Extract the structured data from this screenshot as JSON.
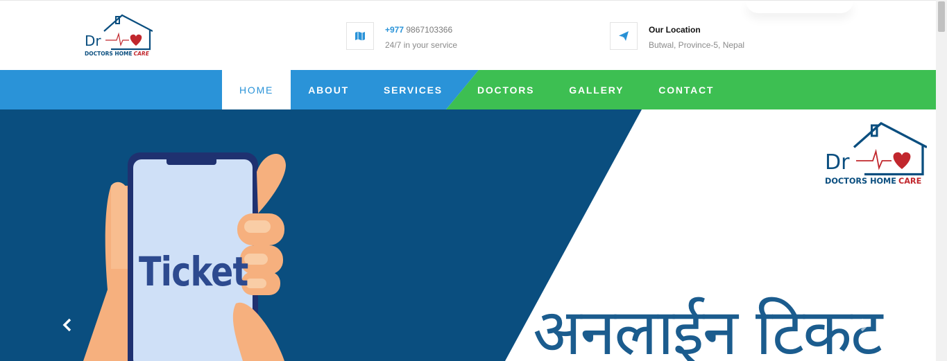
{
  "brand": {
    "logo_initials": "Dr",
    "logo_name_part1": "DOCTORS HOME",
    "logo_name_part2": "CARE",
    "colors": {
      "blue": "#2a93d8",
      "green": "#3dbf52",
      "navy": "#0a4e7f",
      "red": "#c1272d"
    }
  },
  "header": {
    "phone": {
      "icon": "map-icon",
      "prefix": "+977",
      "number": "9867103366",
      "subtitle": "24/7 in your service"
    },
    "location": {
      "icon": "paper-plane-icon",
      "title": "Our Location",
      "subtitle": "Butwal, Province-5, Nepal"
    }
  },
  "nav": {
    "items": [
      {
        "label": "HOME",
        "active": true
      },
      {
        "label": "ABOUT",
        "active": false
      },
      {
        "label": "SERVICES",
        "active": false
      },
      {
        "label": "DOCTORS",
        "active": false
      },
      {
        "label": "GALLERY",
        "active": false
      },
      {
        "label": "CONTACT",
        "active": false
      }
    ]
  },
  "hero": {
    "phone_text": "Ticket",
    "headline_nepali": "अनलाईन टिकट",
    "prev_icon": "chevron-left-icon",
    "next_icon": "chevron-right-icon"
  }
}
